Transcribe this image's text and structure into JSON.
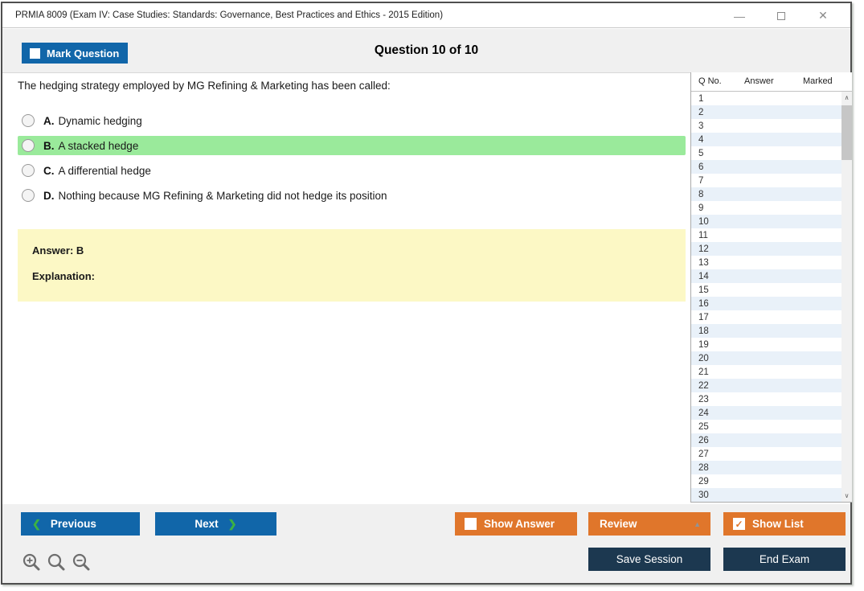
{
  "window": {
    "title": "PRMIA 8009 (Exam IV: Case Studies: Standards: Governance, Best Practices and Ethics - 2015 Edition)"
  },
  "icons": {
    "minimize": "—",
    "close": "✕",
    "chevron_left": "❮",
    "chevron_right": "❯",
    "dropdown_up_arrow": "▲",
    "scroll_up": "∧",
    "scroll_down": "∨",
    "checkmark": "✓"
  },
  "header": {
    "mark_question_label": "Mark Question",
    "question_counter": "Question 10 of 10"
  },
  "question": {
    "text": "The hedging strategy employed by MG Refining & Marketing has been called:",
    "options": [
      {
        "letter": "A.",
        "text": "Dynamic hedging",
        "highlighted": false
      },
      {
        "letter": "B.",
        "text": "A stacked hedge",
        "highlighted": true
      },
      {
        "letter": "C.",
        "text": "A differential hedge",
        "highlighted": false
      },
      {
        "letter": "D.",
        "text": "Nothing because MG Refining & Marketing did not hedge its position",
        "highlighted": false
      }
    ]
  },
  "answer_box": {
    "answer_label": "Answer: B",
    "explanation_label": "Explanation:"
  },
  "question_list": {
    "columns": [
      "Q No.",
      "Answer",
      "Marked"
    ],
    "rows": [
      {
        "q": "1",
        "answer": "",
        "marked": ""
      },
      {
        "q": "2",
        "answer": "",
        "marked": ""
      },
      {
        "q": "3",
        "answer": "",
        "marked": ""
      },
      {
        "q": "4",
        "answer": "",
        "marked": ""
      },
      {
        "q": "5",
        "answer": "",
        "marked": ""
      },
      {
        "q": "6",
        "answer": "",
        "marked": ""
      },
      {
        "q": "7",
        "answer": "",
        "marked": ""
      },
      {
        "q": "8",
        "answer": "",
        "marked": ""
      },
      {
        "q": "9",
        "answer": "",
        "marked": ""
      },
      {
        "q": "10",
        "answer": "",
        "marked": ""
      },
      {
        "q": "11",
        "answer": "",
        "marked": ""
      },
      {
        "q": "12",
        "answer": "",
        "marked": ""
      },
      {
        "q": "13",
        "answer": "",
        "marked": ""
      },
      {
        "q": "14",
        "answer": "",
        "marked": ""
      },
      {
        "q": "15",
        "answer": "",
        "marked": ""
      },
      {
        "q": "16",
        "answer": "",
        "marked": ""
      },
      {
        "q": "17",
        "answer": "",
        "marked": ""
      },
      {
        "q": "18",
        "answer": "",
        "marked": ""
      },
      {
        "q": "19",
        "answer": "",
        "marked": ""
      },
      {
        "q": "20",
        "answer": "",
        "marked": ""
      },
      {
        "q": "21",
        "answer": "",
        "marked": ""
      },
      {
        "q": "22",
        "answer": "",
        "marked": ""
      },
      {
        "q": "23",
        "answer": "",
        "marked": ""
      },
      {
        "q": "24",
        "answer": "",
        "marked": ""
      },
      {
        "q": "25",
        "answer": "",
        "marked": ""
      },
      {
        "q": "26",
        "answer": "",
        "marked": ""
      },
      {
        "q": "27",
        "answer": "",
        "marked": ""
      },
      {
        "q": "28",
        "answer": "",
        "marked": ""
      },
      {
        "q": "29",
        "answer": "",
        "marked": ""
      },
      {
        "q": "30",
        "answer": "",
        "marked": ""
      }
    ]
  },
  "footer": {
    "previous_label": "Previous",
    "next_label": "Next",
    "show_answer_label": "Show Answer",
    "review_label": "Review",
    "show_list_label": "Show List",
    "save_session_label": "Save Session",
    "end_exam_label": "End Exam"
  },
  "colors": {
    "accent_blue": "#1166a9",
    "accent_orange": "#e0762b",
    "accent_navy": "#1c3850",
    "highlight_green": "#9aea9b",
    "answer_yellow": "#fcf8c5",
    "alt_row_blue": "#e9f1f9"
  }
}
